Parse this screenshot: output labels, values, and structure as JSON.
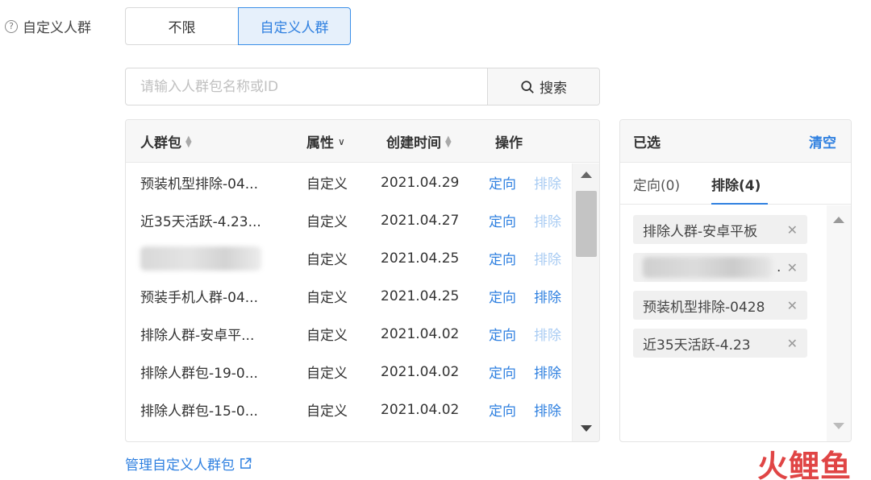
{
  "field": {
    "label": "自定义人群",
    "help_icon": "?"
  },
  "segment": {
    "options": [
      "不限",
      "自定义人群"
    ],
    "selected": "自定义人群"
  },
  "search": {
    "placeholder": "请输入人群包名称或ID",
    "button_label": "搜索"
  },
  "table": {
    "headers": {
      "name": "人群包",
      "attr": "属性",
      "date": "创建时间",
      "action": "操作"
    },
    "rows": [
      {
        "name": "预装机型排除-04...",
        "attr": "自定义",
        "date": "2021.04.29",
        "action1": "定向",
        "action2": "排除",
        "action2_disabled": true
      },
      {
        "name": "近35天活跃-4.23...",
        "attr": "自定义",
        "date": "2021.04.27",
        "action1": "定向",
        "action2": "排除",
        "action2_disabled": true
      },
      {
        "name": "",
        "attr": "自定义",
        "date": "2021.04.25",
        "action1": "定向",
        "action2": "排除",
        "action2_disabled": true,
        "name_blurred": true
      },
      {
        "name": "预装手机人群-04...",
        "attr": "自定义",
        "date": "2021.04.25",
        "action1": "定向",
        "action2": "排除",
        "action2_disabled": false
      },
      {
        "name": "排除人群-安卓平...",
        "attr": "自定义",
        "date": "2021.04.02",
        "action1": "定向",
        "action2": "排除",
        "action2_disabled": true
      },
      {
        "name": "排除人群包-19-0...",
        "attr": "自定义",
        "date": "2021.04.02",
        "action1": "定向",
        "action2": "排除",
        "action2_disabled": false
      },
      {
        "name": "排除人群包-15-0...",
        "attr": "自定义",
        "date": "2021.04.02",
        "action1": "定向",
        "action2": "排除",
        "action2_disabled": false
      }
    ]
  },
  "selected_panel": {
    "title": "已选",
    "clear_label": "清空",
    "tabs": [
      {
        "label": "定向(0)"
      },
      {
        "label": "排除(4)"
      }
    ],
    "active_tab": "排除(4)",
    "tags": [
      {
        "label": "排除人群-安卓平板"
      },
      {
        "label": "",
        "blurred": true,
        "suffix": "."
      },
      {
        "label": "预装机型排除-0428"
      },
      {
        "label": "近35天活跃-4.23"
      }
    ]
  },
  "footer": {
    "manage_link": "管理自定义人群包"
  },
  "watermark": {
    "text": "火鲤鱼"
  },
  "colors": {
    "accent": "#2f80e0",
    "accent_disabled": "#a9ccf3",
    "active_bg": "#e6f0fb",
    "watermark": "#e04545"
  }
}
